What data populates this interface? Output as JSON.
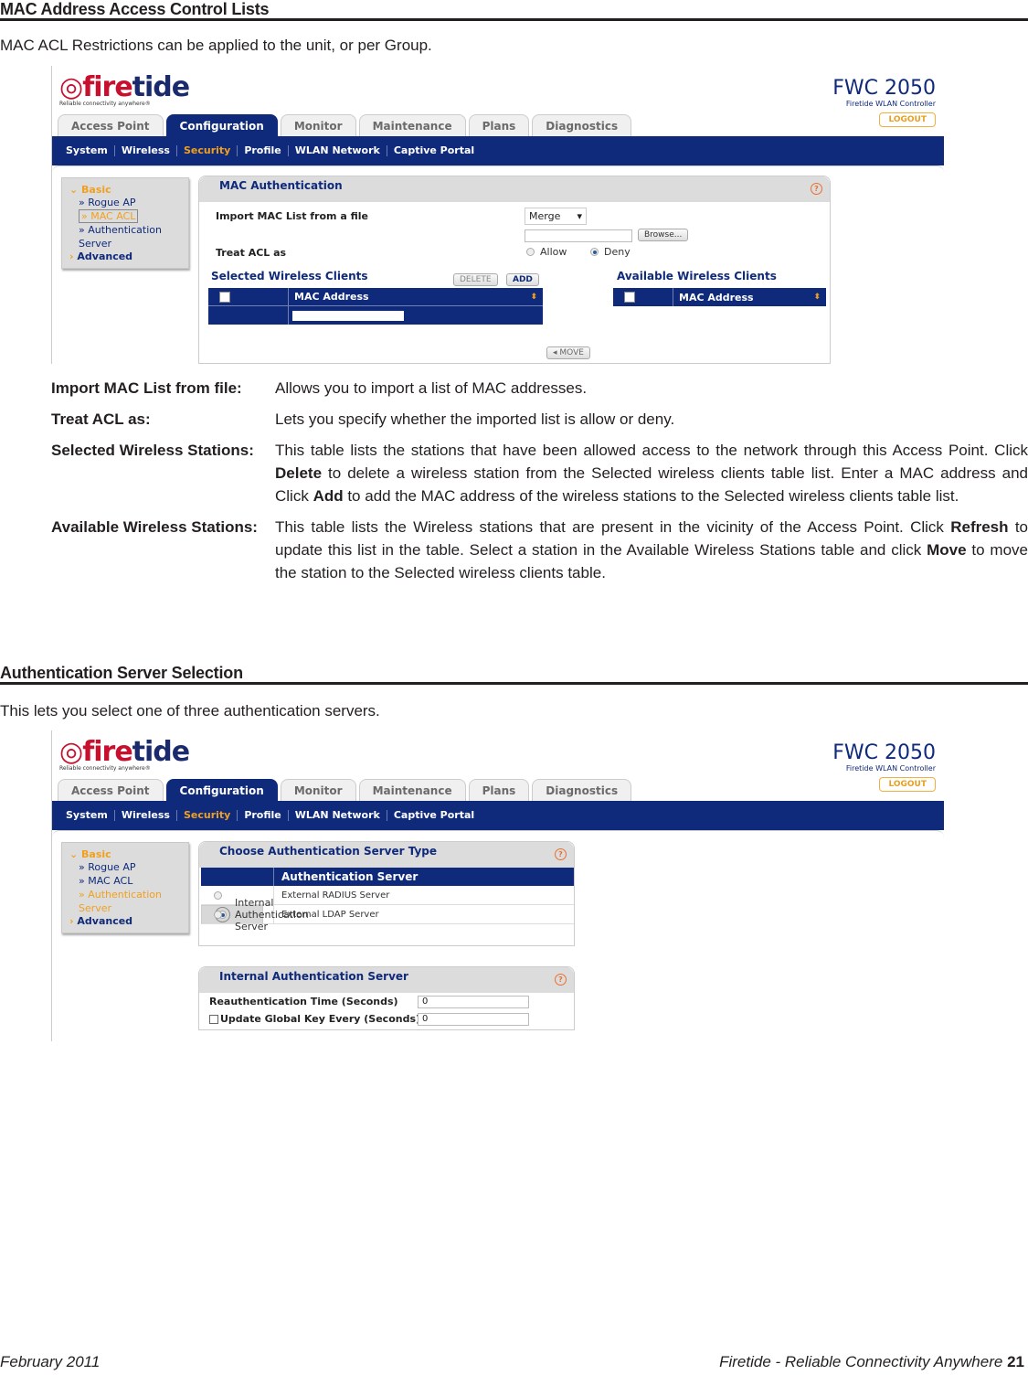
{
  "section1": {
    "title": "MAC Address Access Control Lists",
    "intro": "MAC ACL Restrictions can be applied to the unit, or per Group."
  },
  "ui": {
    "logo_text_1": "fire",
    "logo_text_2": "tide",
    "logo_tagline": "Reliable connectivity anywhere®",
    "model": "FWC 2050",
    "model_sub": "Firetide WLAN Controller",
    "logout": "LOGOUT",
    "tabs": [
      "Access Point",
      "Configuration",
      "Monitor",
      "Maintenance",
      "Plans",
      "Diagnostics"
    ],
    "active_tab": "Configuration",
    "subnav": [
      "System",
      "Wireless",
      "Security",
      "Profile",
      "WLAN Network",
      "Captive Portal"
    ],
    "active_subnav": "Security",
    "leftnav": {
      "basic": "Basic",
      "rogue_ap": "» Rogue AP",
      "mac_acl": "» MAC ACL",
      "auth_server_1": "» Authentication",
      "auth_server_2": "Server",
      "advanced": "Advanced"
    },
    "help_icon": "?"
  },
  "mac_auth": {
    "panel_title": "MAC Authentication",
    "import_label": "Import MAC List from a file",
    "import_mode": "Merge",
    "file_value": "",
    "browse": "Browse...",
    "treat_label": "Treat ACL as",
    "allow": "Allow",
    "deny": "Deny",
    "treat_selected": "Deny",
    "selected_title": "Selected Wireless Clients",
    "delete_btn": "DELETE",
    "add_btn": "ADD",
    "available_title": "Available Wireless Clients",
    "col_mac": "MAC Address",
    "move_btn": "◂ MOVE"
  },
  "defs1": [
    {
      "term": "Import MAC List from file:",
      "desc": "Allows you to import a list of MAC addresses."
    },
    {
      "term": "Treat ACL as:",
      "desc": "Lets you specify whether the imported list is allow or deny."
    },
    {
      "term": "Selected Wireless Stations:",
      "desc_parts": [
        "This table lists the stations that have been allowed access to the network through this Access Point. Click ",
        "Delete",
        " to delete a wireless station from the Selected wireless clients table list. Enter a MAC address and Click ",
        "Add",
        " to add the MAC address of the wireless stations to the Selected wireless clients table list."
      ]
    },
    {
      "term": "Available Wireless Stations:",
      "desc_parts": [
        "This table lists the Wireless stations that are present in the vicinity of the Access Point. Click ",
        "Refresh",
        " to update this list in the table. Select a station in the Available Wireless Stations table and click ",
        "Move",
        " to move the station to the Selected wireless clients table."
      ]
    }
  ],
  "section2": {
    "title": "Authentication Server Selection",
    "intro": "This lets you select one of three authentication servers."
  },
  "auth": {
    "panel_title": "Choose Authentication Server Type",
    "col_header": "Authentication Server",
    "servers": [
      "External RADIUS Server",
      "Internal Authentication Server",
      "External LDAP Server"
    ],
    "selected_server": "Internal Authentication Server",
    "internal_title": "Internal Authentication Server",
    "reauth_label": "Reauthentication Time (Seconds)",
    "reauth_value": "0",
    "gkey_label": "Update Global Key Every (Seconds)",
    "gkey_value": "0",
    "gkey_checked": false
  },
  "footer": {
    "date": "February 2011",
    "tagline": "Firetide - Reliable Connectivity Anywhere",
    "page": "21"
  }
}
